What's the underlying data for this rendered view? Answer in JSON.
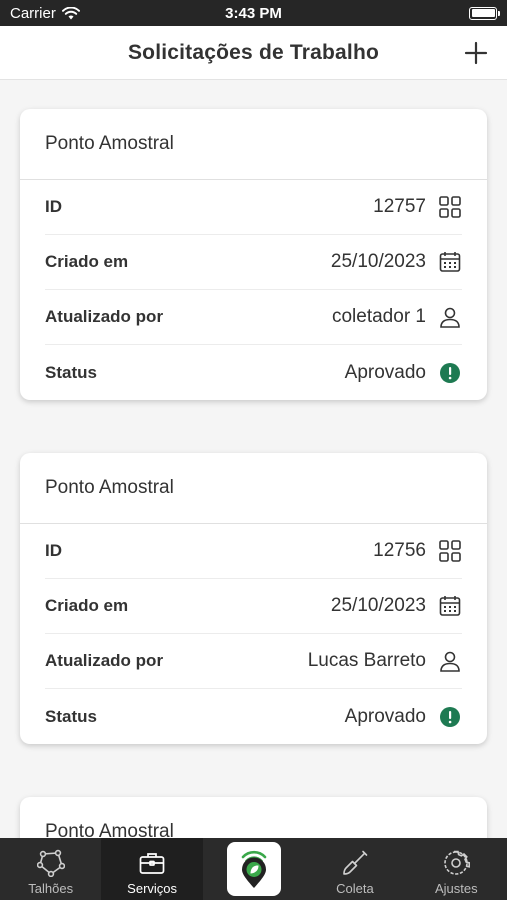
{
  "status_bar": {
    "carrier": "Carrier",
    "time": "3:43 PM"
  },
  "nav": {
    "title": "Solicitações de Trabalho",
    "add_icon": "plus-icon"
  },
  "labels": {
    "id": "ID",
    "created": "Criado em",
    "updated_by": "Atualizado por",
    "status": "Status"
  },
  "cards": [
    {
      "title": "Ponto Amostral",
      "id": "12757",
      "created": "25/10/2023",
      "updated_by": "coletador 1",
      "status": "Aprovado"
    },
    {
      "title": "Ponto Amostral",
      "id": "12756",
      "created": "25/10/2023",
      "updated_by": "Lucas Barreto",
      "status": "Aprovado"
    },
    {
      "title": "Ponto Amostral"
    }
  ],
  "tabs": [
    {
      "label": "Talhões",
      "icon": "polygon-icon",
      "active": false
    },
    {
      "label": "Serviços",
      "icon": "briefcase-icon",
      "active": true
    },
    {
      "label": "",
      "icon": "location-leaf-icon",
      "active": false
    },
    {
      "label": "Coleta",
      "icon": "shovel-icon",
      "active": false
    },
    {
      "label": "Ajustes",
      "icon": "gear-icon",
      "active": false
    }
  ],
  "colors": {
    "status_ok": "#1e7a52",
    "brand_green": "#3aa84a",
    "tab_bg": "#2b2b2b"
  }
}
